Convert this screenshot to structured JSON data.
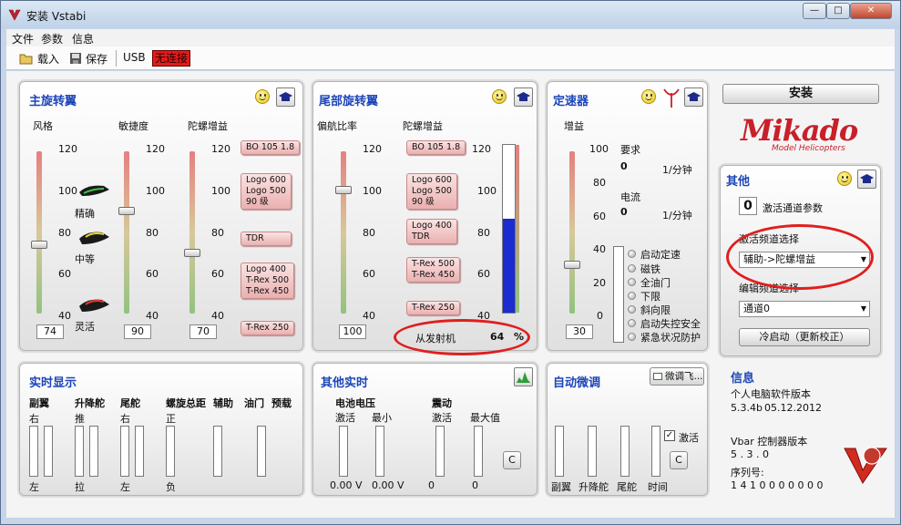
{
  "window": {
    "title": "安装 Vstabi",
    "minimize": "—",
    "maximize": "□",
    "close": "✕"
  },
  "menu": [
    "文件",
    "参数",
    "信息"
  ],
  "toolbar": {
    "load": "载入",
    "save": "保存",
    "usb": "USB",
    "usb_status": "无连接"
  },
  "main_rotor": {
    "title": "主旋转翼",
    "style_label": "风格",
    "agility_label": "敏捷度",
    "gyro_label": "陀螺增益",
    "style_ticks": [
      "120",
      "100",
      "80",
      "60",
      "40"
    ],
    "agility_ticks": [
      "120",
      "100",
      "80",
      "60",
      "40"
    ],
    "gyro_ticks": [
      "120",
      "100",
      "80",
      "60",
      "40"
    ],
    "style_options": [
      "精确",
      "中等",
      "灵活"
    ],
    "style_value": "74",
    "agility_value": "90",
    "gyro_value": "70",
    "callouts": [
      "BO 105 1.8",
      "Logo 600\nLogo 500\n90 级",
      "TDR",
      "Logo 400\nT-Rex 500\nT-Rex 450",
      "T-Rex 250"
    ]
  },
  "tail_rotor": {
    "title": "尾部旋转翼",
    "heading_label": "偏航比率",
    "gyro_label": "陀螺增益",
    "heading_ticks": [
      "120",
      "100",
      "80",
      "60",
      "40"
    ],
    "gyro_ticks": [
      "120",
      "100",
      "80",
      "60",
      "40"
    ],
    "heading_value": "100",
    "callouts": [
      "BO 105 1.8",
      "Logo 600\nLogo 500\n90 级",
      "Logo 400\nTDR",
      "T-Rex 500\nT-Rex 450",
      "T-Rex 250"
    ],
    "from_tx_label": "从发射机",
    "from_tx_value": "64",
    "from_tx_unit": "%",
    "gain_level_pct": 56
  },
  "governor": {
    "title": "定速器",
    "gain_label": "增益",
    "gain_ticks": [
      "100",
      "80",
      "60",
      "40",
      "20",
      "0"
    ],
    "gain_value": "30",
    "required_label": "要求",
    "required_value": "0",
    "required_unit": "1/分钟",
    "current_label": "电流",
    "current_value": "0",
    "current_unit": "1/分钟",
    "options": [
      "启动定速",
      "磁铁",
      "全油门",
      "下限",
      "斜向限",
      "启动失控安全",
      "紧急状况防护"
    ]
  },
  "install_button": "安装",
  "brand": {
    "name": "Mikado",
    "sub": "Model Helicopters"
  },
  "other": {
    "title": "其他",
    "activation_value": "0",
    "activation_label": "激活通道参数",
    "channel_select_label": "激活频道选择",
    "channel_select_value": "辅助->陀螺增益",
    "edit_channel_label": "编辑频道选择",
    "edit_channel_value": "通道0",
    "cold_start": "冷启动（更新校正）"
  },
  "realtime": {
    "title": "实时显示",
    "cols": [
      "副翼",
      "升降舵",
      "尾舵",
      "螺旋总距",
      "辅助",
      "油门",
      "预载"
    ],
    "top": [
      "右",
      "推",
      "右",
      "正"
    ],
    "bottom": [
      "左",
      "拉",
      "左",
      "负"
    ]
  },
  "other_realtime": {
    "title": "其他实时",
    "battery_label": "电池电压",
    "vibration_label": "震动",
    "active": "激活",
    "min": "最小",
    "max": "最大值",
    "v1": "0.00",
    "v2": "0.00",
    "unit": "V",
    "c1": "0",
    "c2": "0",
    "clear": "C"
  },
  "autotrim": {
    "title": "自动微调",
    "finetune": "微调飞...",
    "active": "激活",
    "cols": [
      "副翼",
      "升降舵",
      "尾舵",
      "时间"
    ],
    "clear": "C"
  },
  "info": {
    "title": "信息",
    "pc_label": "个人电脑软件版本",
    "pc_version": "5.3.4b",
    "pc_date": "05.12.2012",
    "ctrl_label": "Vbar 控制器版本",
    "ctrl_version": "5 . 3 . 0",
    "serial_label": "序列号:",
    "serial": "1 4 1 0 0 0 0 0 0 0"
  }
}
